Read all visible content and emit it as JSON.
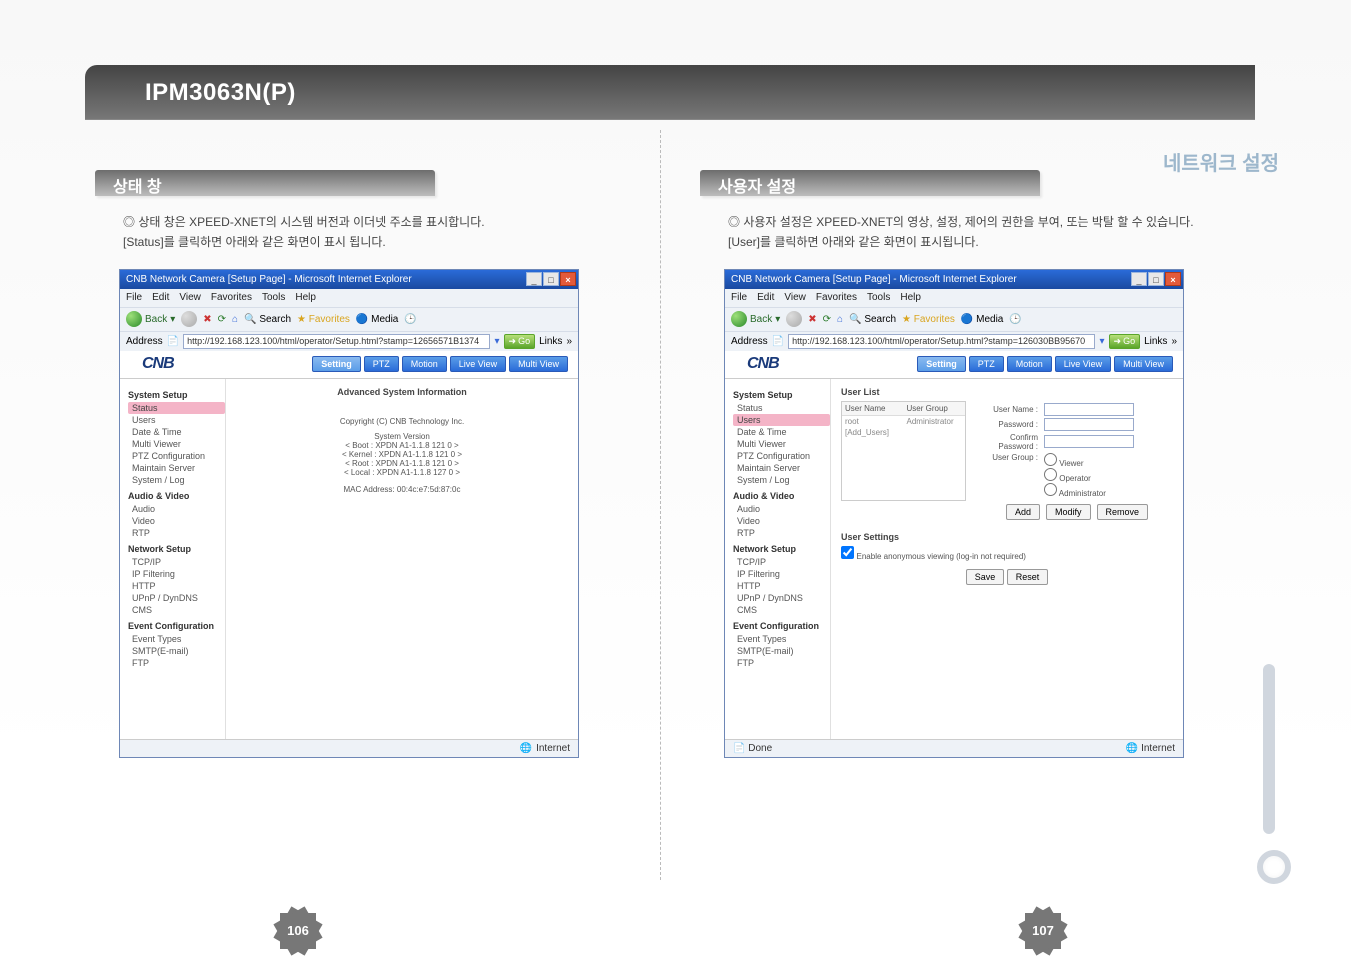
{
  "model": "IPM3063N(P)",
  "section_label_right": "네트워크 설정",
  "left": {
    "header": "상태 창",
    "desc_line1": "◎ 상태 창은 XPEED-XNET의 시스템 버전과 이더넷 주소를 표시합니다.",
    "desc_line2": "[Status]를 클릭하면 아래와 같은 화면이 표시 됩니다.",
    "ie_title": "CNB Network Camera [Setup Page] - Microsoft Internet Explorer",
    "addr_url": "http://192.168.123.100/html/operator/Setup.html?stamp=12656571B1374",
    "pane_title": "Advanced System Information",
    "copyright": "Copyright (C) CNB Technology Inc.",
    "sys_ver_label": "System Version",
    "ver_boot": "< Boot    : XPDN A1-1.1.8 121 0 >",
    "ver_kernel": "< Kernel : XPDN A1-1.1.8 121 0 >",
    "ver_root": "< Root    : XPDN A1-1.1.8 121 0 >",
    "ver_local": "< Local   : XPDN A1-1.1.8 127 0 >",
    "mac": "MAC Address: 00:4c:e7:5d:87:0c",
    "status_text": "Internet",
    "page_num": "106"
  },
  "right": {
    "header": "사용자 설정",
    "desc_line1": "◎ 사용자 설정은 XPEED-XNET의 영상, 설정, 제어의 권한을 부여, 또는 박탈 할 수 있습니다.",
    "desc_line2": "[User]를 클릭하면 아래와 같은 화면이 표시됩니다.",
    "ie_title": "CNB Network Camera [Setup Page] - Microsoft Internet Explorer",
    "addr_url": "http://192.168.123.100/html/operator/Setup.html?stamp=126030BB95670",
    "userlist_title": "User List",
    "col_user": "User Name",
    "col_group": "User Group",
    "row_user": "root",
    "row_group": "Administrator",
    "add_users_link": "[Add_Users]",
    "label_username": "User Name :",
    "label_password": "Password :",
    "label_confirm": "Confirm Password :",
    "label_usergroup": "User Group :",
    "role_viewer": "Viewer",
    "role_operator": "Operator",
    "role_admin": "Administrator",
    "btn_add": "Add",
    "btn_modify": "Modify",
    "btn_remove": "Remove",
    "usersettings_title": "User Settings",
    "anon_label": "Enable anonymous viewing (log-in not required)",
    "btn_save": "Save",
    "btn_reset": "Reset",
    "status_text": "Internet",
    "status_done": "Done",
    "page_num": "107"
  },
  "ie_menus": {
    "file": "File",
    "edit": "Edit",
    "view": "View",
    "fav": "Favorites",
    "tools": "Tools",
    "help": "Help"
  },
  "ie_tb": {
    "back": "Back",
    "search": "Search",
    "favorites": "Favorites",
    "media": "Media"
  },
  "ie_addr": {
    "label": "Address",
    "go": "Go",
    "links": "Links"
  },
  "cnb_logo": "CNB",
  "tabs": {
    "setting": "Setting",
    "ptz": "PTZ",
    "motion": "Motion",
    "liveview": "Live View",
    "multiview": "Multi View"
  },
  "sidebar": {
    "g1": "System Setup",
    "g1_items": [
      "Status",
      "Users",
      "Date & Time",
      "Multi Viewer",
      "PTZ Configuration",
      "Maintain Server",
      "System / Log"
    ],
    "g2": "Audio & Video",
    "g2_items": [
      "Audio",
      "Video",
      "RTP"
    ],
    "g3": "Network Setup",
    "g3_items": [
      "TCP/IP",
      "IP Filtering",
      "HTTP",
      "UPnP / DynDNS",
      "CMS"
    ],
    "g4": "Event Configuration",
    "g4_items": [
      "Event Types",
      "SMTP(E-mail)",
      "FTP"
    ]
  }
}
